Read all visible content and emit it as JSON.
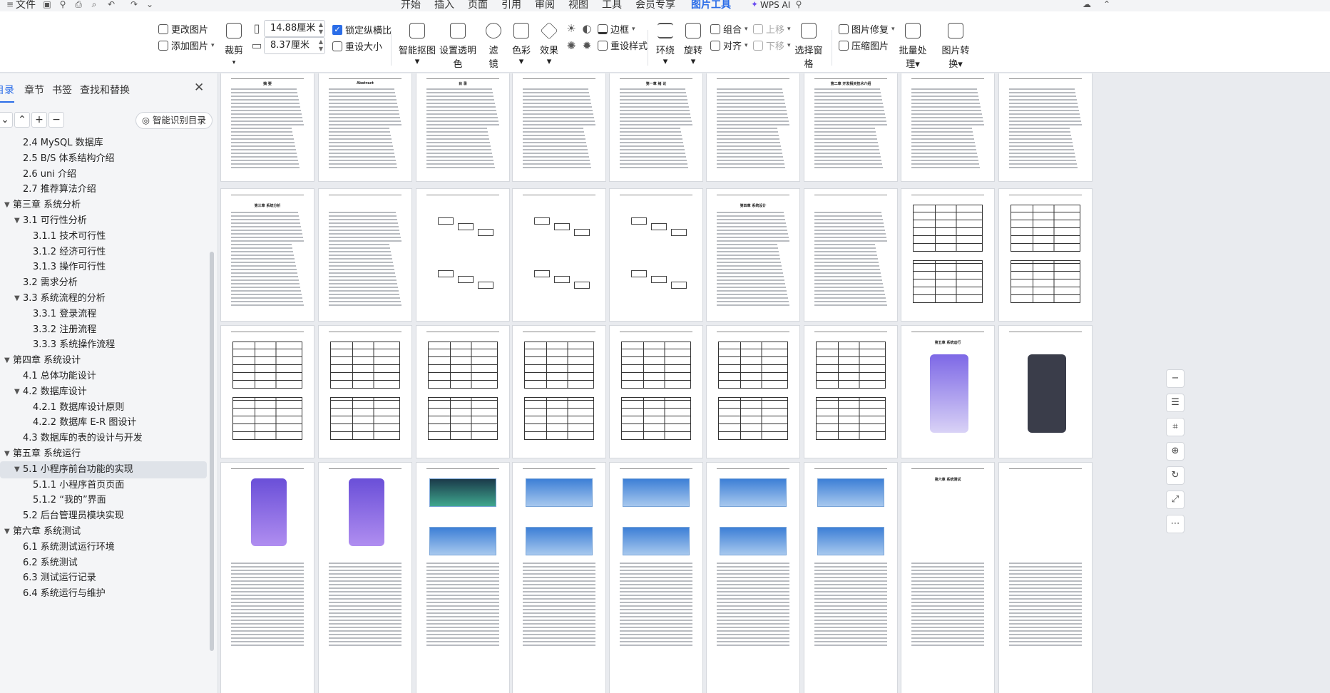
{
  "menubar": {
    "file_label": "文件",
    "tabs": [
      "开始",
      "插入",
      "页面",
      "引用",
      "审阅",
      "视图",
      "工具",
      "会员专享",
      "图片工具"
    ],
    "active_tab": "图片工具",
    "wps_ai_label": "WPS AI"
  },
  "ribbon": {
    "change_image": "更改图片",
    "add_image": "添加图片",
    "crop": "裁剪",
    "width_value": "14.88厘米",
    "height_value": "8.37厘米",
    "lock_ratio": "锁定纵横比",
    "reset_size": "重设大小",
    "smart_cutout": "智能抠图",
    "set_transparent": "设置透明色",
    "filter": "滤镜",
    "color": "色彩",
    "effects": "效果",
    "border": "边框",
    "reset_style": "重设样式",
    "wrap": "环绕",
    "rotate": "旋转",
    "group": "组合",
    "align": "对齐",
    "move_up": "上移",
    "move_down": "下移",
    "selection_pane": "选择窗格",
    "image_repair": "图片修复",
    "compress": "压缩图片",
    "batch": "批量处理",
    "convert": "图片转换"
  },
  "nav": {
    "tabs": [
      "目录",
      "章节",
      "书签",
      "查找和替换"
    ],
    "active_tab": "目录",
    "smart_toc": "智能识别目录",
    "toc": [
      {
        "label": "2.4 MySQL 数据库",
        "level": 2
      },
      {
        "label": "2.5 B/S 体系结构介绍",
        "level": 2
      },
      {
        "label": "2.6 uni 介绍",
        "level": 2
      },
      {
        "label": "2.7 推荐算法介绍",
        "level": 2
      },
      {
        "label": "第三章 系统分析",
        "level": 1
      },
      {
        "label": "3.1 可行性分析",
        "level": 2
      },
      {
        "label": "3.1.1 技术可行性",
        "level": 3
      },
      {
        "label": "3.1.2 经济可行性",
        "level": 3
      },
      {
        "label": "3.1.3 操作可行性",
        "level": 3
      },
      {
        "label": "3.2 需求分析",
        "level": 2
      },
      {
        "label": "3.3 系统流程的分析",
        "level": 2
      },
      {
        "label": "3.3.1 登录流程",
        "level": 3
      },
      {
        "label": "3.3.2 注册流程",
        "level": 3
      },
      {
        "label": "3.3.3 系统操作流程",
        "level": 3
      },
      {
        "label": "第四章 系统设计",
        "level": 1
      },
      {
        "label": "4.1 总体功能设计",
        "level": 2
      },
      {
        "label": "4.2 数据库设计",
        "level": 2
      },
      {
        "label": "4.2.1 数据库设计原则",
        "level": 3
      },
      {
        "label": "4.2.2 数据库 E-R 图设计",
        "level": 3
      },
      {
        "label": "4.3 数据库的表的设计与开发",
        "level": 2
      },
      {
        "label": "第五章 系统运行",
        "level": 1
      },
      {
        "label": "5.1 小程序前台功能的实现",
        "level": 2
      },
      {
        "label": "5.1.1 小程序首页页面",
        "level": 3
      },
      {
        "label": "5.1.2 “我的”界面",
        "level": 3
      },
      {
        "label": "5.2 后台管理员模块实现",
        "level": 2
      },
      {
        "label": "第六章 系统测试",
        "level": 1
      },
      {
        "label": "6.1 系统测试运行环境",
        "level": 2
      },
      {
        "label": "6.2 系统测试",
        "level": 2
      },
      {
        "label": "6.3 测试运行记录",
        "level": 2
      },
      {
        "label": "6.4 系统运行与维护",
        "level": 2
      }
    ],
    "selected_index": 21
  },
  "pages": {
    "row1_labels": [
      "摘 要",
      "Abstract",
      "目 录",
      "",
      "第一章 绪 论",
      "",
      "第二章 开发相关技术介绍",
      "",
      ""
    ],
    "row2_labels": [
      "第三章 系统分析",
      "",
      "",
      "",
      "",
      "第四章 系统设计",
      "",
      "",
      ""
    ],
    "row3_labels": [
      "",
      "",
      "",
      "",
      "",
      "",
      "",
      "第五章 系统运行",
      ""
    ],
    "row4_labels": [
      "",
      "",
      "",
      "",
      "",
      "",
      "",
      "第六章 系统测试",
      ""
    ]
  }
}
